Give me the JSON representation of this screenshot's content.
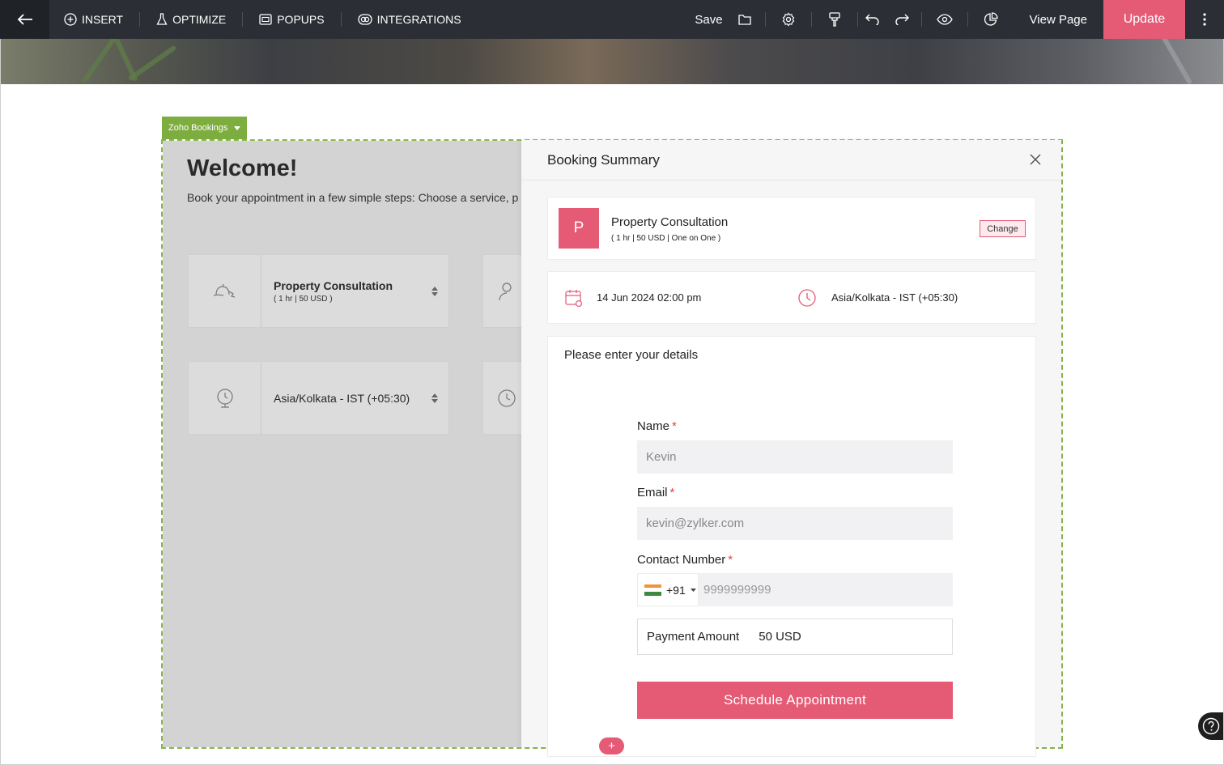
{
  "toolbar": {
    "insert_label": "INSERT",
    "optimize_label": "OPTIMIZE",
    "popups_label": "POPUPS",
    "integrations_label": "INTEGRATIONS",
    "save_label": "Save",
    "view_page_label": "View Page",
    "update_label": "Update"
  },
  "widget": {
    "tag_label": "Zoho Bookings",
    "welcome_title": "Welcome!",
    "welcome_subtitle": "Book your appointment in a few simple steps: Choose a service, p",
    "service_card": {
      "title": "Property Consultation",
      "meta": "( 1 hr | 50 USD )"
    },
    "timezone_card": {
      "title": "Asia/Kolkata - IST (+05:30)"
    }
  },
  "summary": {
    "title": "Booking Summary",
    "service": {
      "avatar_letter": "P",
      "name": "Property Consultation",
      "meta": "( 1 hr | 50 USD | One on One )",
      "change_label": "Change"
    },
    "datetime": "14 Jun 2024 02:00 pm",
    "timezone": "Asia/Kolkata - IST (+05:30)",
    "details_title": "Please enter your details",
    "form": {
      "name_label": "Name",
      "name_value": "Kevin",
      "email_label": "Email",
      "email_value": "kevin@zylker.com",
      "contact_label": "Contact Number",
      "country_code": "+91",
      "phone_placeholder": "9999999999",
      "required_mark": "*",
      "payment_label": "Payment Amount",
      "payment_value": "50 USD",
      "submit_label": "Schedule Appointment"
    }
  },
  "colors": {
    "accent": "#e55a75",
    "widget_outline": "#86b74c",
    "toolbar_bg": "#2b2e34"
  },
  "add_section_label": "+"
}
